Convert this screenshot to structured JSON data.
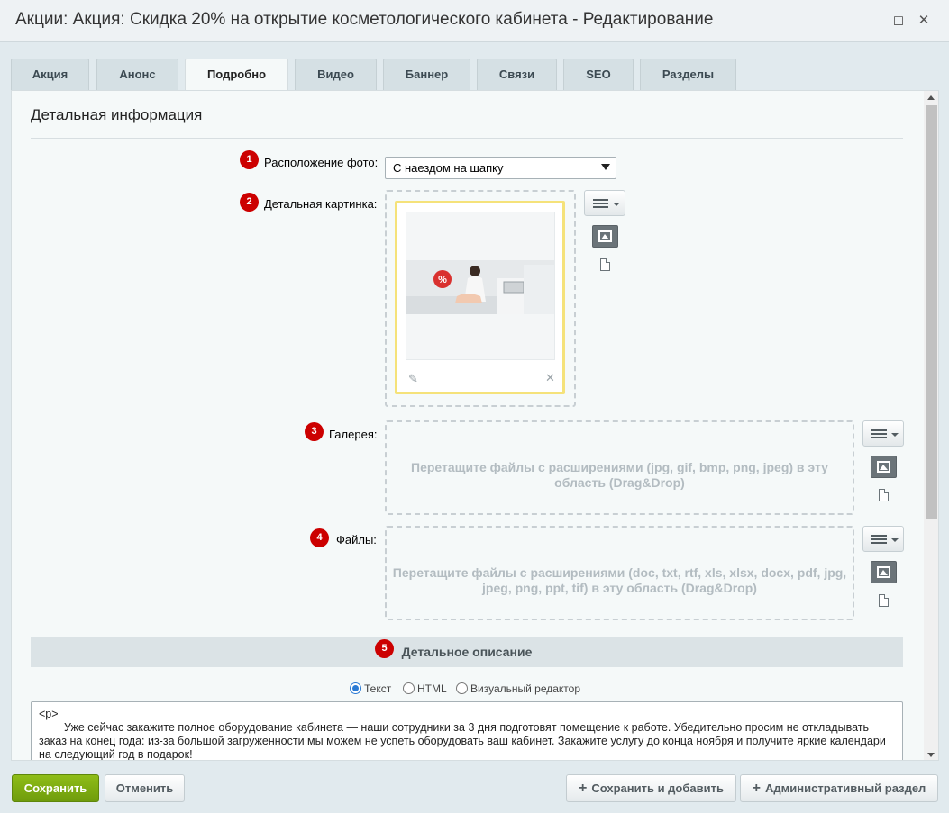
{
  "window": {
    "title": "Акции: Акция: Скидка 20% на открытие косметологического кабинета - Редактирование",
    "maximize_icon": "maximize-icon",
    "close_icon": "close-icon"
  },
  "tabs": [
    {
      "label": "Акция"
    },
    {
      "label": "Анонс"
    },
    {
      "label": "Подробно",
      "active": true
    },
    {
      "label": "Видео"
    },
    {
      "label": "Баннер"
    },
    {
      "label": "Связи"
    },
    {
      "label": "SEO"
    },
    {
      "label": "Разделы"
    }
  ],
  "section": {
    "title": "Детальная информация"
  },
  "fields": {
    "photo_position": {
      "num": "1",
      "label": "Расположение фото:",
      "value": "С наездом на шапку"
    },
    "detail_picture": {
      "num": "2",
      "label": "Детальная картинка:"
    },
    "gallery": {
      "num": "3",
      "label": "Галерея:",
      "dropzone_text": "Перетащите файлы с расширениями (jpg, gif, bmp, png, jpeg) в эту область (Drag&Drop)"
    },
    "files": {
      "num": "4",
      "label": "Файлы:",
      "dropzone_text": "Перетащите файлы с расширениями (doc, txt, rtf, xls, xlsx, docx, pdf, jpg, jpeg, png, ppt, tif) в эту область (Drag&Drop)"
    }
  },
  "description": {
    "num": "5",
    "title": "Детальное описание",
    "modes": [
      {
        "label": "Текст",
        "selected": true
      },
      {
        "label": "HTML",
        "selected": false
      },
      {
        "label": "Визуальный редактор",
        "selected": false
      }
    ],
    "text_tag": "<p>",
    "text": "Уже сейчас закажите полное оборудование кабинета — наши сотрудники за 3 дня подготовят помещение к работе. Убедительно просим не откладывать заказ на конец года: из-за большой загруженности мы можем не успеть оборудовать ваш кабинет. Закажите услугу до конца ноября и получите яркие календари на следующий год в подарок!"
  },
  "footer": {
    "save": "Сохранить",
    "cancel": "Отменить",
    "save_and_add": "Сохранить и добавить",
    "admin_section": "Административный раздел"
  },
  "colors": {
    "accent_green": "#7aa812",
    "badge_red": "#cc0000",
    "preview_border": "#f5e27a"
  }
}
